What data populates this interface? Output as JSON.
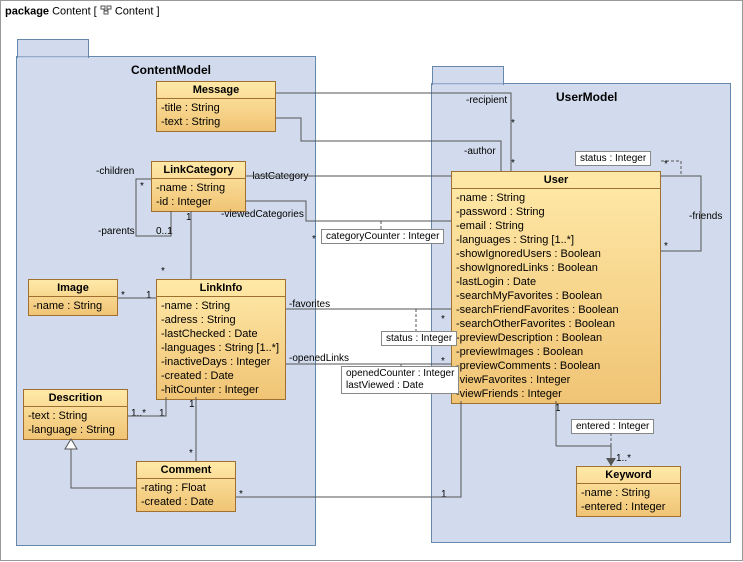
{
  "header": {
    "prefix": "package",
    "name": "Content",
    "tab": "Content"
  },
  "frames": {
    "contentModel": {
      "title": "ContentModel"
    },
    "userModel": {
      "title": "UserModel"
    }
  },
  "classes": {
    "message": {
      "name": "Message",
      "attrs": [
        "-title : String",
        "-text : String"
      ]
    },
    "linkCategory": {
      "name": "LinkCategory",
      "attrs": [
        "-name : String",
        "-id : Integer"
      ]
    },
    "image": {
      "name": "Image",
      "attrs": [
        "-name : String"
      ]
    },
    "linkInfo": {
      "name": "LinkInfo",
      "attrs": [
        "-name : String",
        "-adress : String",
        "-lastChecked : Date",
        "-languages : String [1..*]",
        "-inactiveDays : Integer",
        "-created : Date",
        "-hitCounter : Integer"
      ]
    },
    "descrition": {
      "name": "Descrition",
      "attrs": [
        "-text : String",
        "-language : String"
      ]
    },
    "comment": {
      "name": "Comment",
      "attrs": [
        "-rating : Float",
        "-created : Date"
      ]
    },
    "user": {
      "name": "User",
      "attrs": [
        "-name : String",
        "-password : String",
        "-email : String",
        "-languages : String [1..*]",
        "-showIgnoredUsers : Boolean",
        "-showIgnoredLinks : Boolean",
        "-lastLogin : Date",
        "-searchMyFavorites : Boolean",
        "-searchFriendFavorites : Boolean",
        "-searchOtherFavorites : Boolean",
        "-previewDescription : Boolean",
        "-previewImages : Boolean",
        "-previewComments : Boolean",
        "-viewFavorites : Integer",
        "-viewFriends : Integer"
      ]
    },
    "keyword": {
      "name": "Keyword",
      "attrs": [
        "-name : String",
        "-entered : Integer"
      ]
    }
  },
  "assocBoxes": {
    "categoryCounter": "categoryCounter : Integer",
    "status1": "status : Integer",
    "status2": "status : Integer",
    "openedViewed": [
      "openedCounter : Integer",
      "lastViewed : Date"
    ],
    "entered": "entered : Integer"
  },
  "labels": {
    "recipient": "-recipient",
    "author": "-author",
    "children": "-children",
    "parents": "-parents",
    "lastCategory": "-lastCategory",
    "viewedCategories": "-viewedCategories",
    "favorites": "-favorites",
    "openedLinks": "-openedLinks",
    "friends": "-friends"
  },
  "mults": {
    "star": "*",
    "one": "1",
    "zeroOne": "0..1",
    "onePlus": "1..*",
    "oneStar": "1..*"
  },
  "chart_data": {
    "type": "uml_class_diagram",
    "package": "Content",
    "frames": [
      "ContentModel",
      "UserModel"
    ],
    "classes": [
      {
        "name": "Message",
        "frame": "ContentModel",
        "attributes": [
          "title:String",
          "text:String"
        ]
      },
      {
        "name": "LinkCategory",
        "frame": "ContentModel",
        "attributes": [
          "name:String",
          "id:Integer"
        ]
      },
      {
        "name": "Image",
        "frame": "ContentModel",
        "attributes": [
          "name:String"
        ]
      },
      {
        "name": "LinkInfo",
        "frame": "ContentModel",
        "attributes": [
          "name:String",
          "adress:String",
          "lastChecked:Date",
          "languages:String[1..*]",
          "inactiveDays:Integer",
          "created:Date",
          "hitCounter:Integer"
        ]
      },
      {
        "name": "Descrition",
        "frame": "ContentModel",
        "attributes": [
          "text:String",
          "language:String"
        ]
      },
      {
        "name": "Comment",
        "frame": "ContentModel",
        "attributes": [
          "rating:Float",
          "created:Date"
        ]
      },
      {
        "name": "User",
        "frame": "UserModel",
        "attributes": [
          "name:String",
          "password:String",
          "email:String",
          "languages:String[1..*]",
          "showIgnoredUsers:Boolean",
          "showIgnoredLinks:Boolean",
          "lastLogin:Date",
          "searchMyFavorites:Boolean",
          "searchFriendFavorites:Boolean",
          "searchOtherFavorites:Boolean",
          "previewDescription:Boolean",
          "previewImages:Boolean",
          "previewComments:Boolean",
          "viewFavorites:Integer",
          "viewFriends:Integer"
        ]
      },
      {
        "name": "Keyword",
        "frame": "UserModel",
        "attributes": [
          "name:String",
          "entered:Integer"
        ]
      }
    ],
    "associations": [
      {
        "from": "Message",
        "to": "User",
        "role": "recipient",
        "toMult": "*"
      },
      {
        "from": "Message",
        "to": "User",
        "role": "author",
        "toMult": "*"
      },
      {
        "from": "LinkCategory",
        "to": "LinkCategory",
        "role": "children/parents",
        "fromMult": "*",
        "toMult": "0..1"
      },
      {
        "from": "LinkCategory",
        "to": "User",
        "role": "lastCategory",
        "toMult": "1"
      },
      {
        "from": "LinkCategory",
        "to": "User",
        "role": "viewedCategories",
        "toMult": "*",
        "assocClassAttrs": [
          "categoryCounter:Integer"
        ]
      },
      {
        "from": "LinkInfo",
        "to": "User",
        "role": "favorites",
        "toMult": "*",
        "assocClassAttrs": [
          "status:Integer"
        ]
      },
      {
        "from": "LinkInfo",
        "to": "User",
        "role": "openedLinks",
        "toMult": "*",
        "assocClassAttrs": [
          "openedCounter:Integer",
          "lastViewed:Date"
        ]
      },
      {
        "from": "User",
        "to": "User",
        "role": "friends",
        "toMult": "*",
        "assocClassAttrs": [
          "status:Integer"
        ]
      },
      {
        "from": "User",
        "to": "Keyword",
        "toMult": "1..*",
        "assocClassAttrs": [
          "entered:Integer"
        ]
      },
      {
        "from": "LinkCategory",
        "to": "LinkInfo",
        "fromMult": "1",
        "toMult": "*"
      },
      {
        "from": "LinkInfo",
        "to": "Image",
        "fromMult": "1",
        "toMult": "*"
      },
      {
        "from": "LinkInfo",
        "to": "Descrition",
        "fromMult": "1",
        "toMult": "1..*"
      },
      {
        "from": "LinkInfo",
        "to": "Comment",
        "fromMult": "1",
        "toMult": "*"
      },
      {
        "from": "Comment",
        "to": "Descrition",
        "generalization": true
      },
      {
        "from": "Comment",
        "to": "User",
        "fromMult": "*",
        "toMult": "1"
      }
    ]
  }
}
